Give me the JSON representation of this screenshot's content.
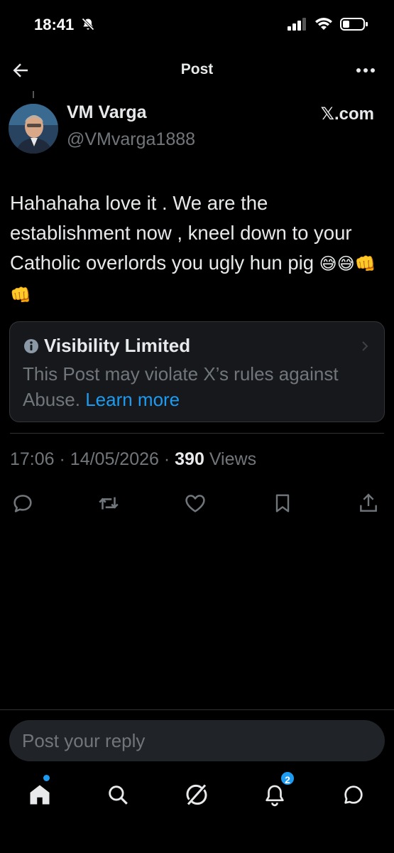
{
  "status_bar": {
    "time": "18:41",
    "icons": [
      "bell-slash-icon",
      "cellular-signal-icon",
      "wifi-icon",
      "battery-icon"
    ]
  },
  "header": {
    "title": "Post",
    "icons": [
      "back-arrow-icon",
      "more-icon"
    ]
  },
  "post": {
    "author_name": "VM Varga",
    "author_handle": "@VMvarga1888",
    "source_badge": "𝕏.com",
    "text": "Hahahaha love it . We are the establishment now , kneel down to your Catholic overlords you ugly hun pig",
    "emojis": "😅😅👊👊",
    "timestamp": "17:06",
    "date": "14/05/2026",
    "separator": "·",
    "views_count": "390",
    "views_label": "Views"
  },
  "visibility_notice": {
    "title": "Visibility Limited",
    "body": "This Post may violate X’s rules against Abuse.",
    "link": "Learn more"
  },
  "actions": [
    "reply-icon",
    "repost-icon",
    "like-icon",
    "bookmark-icon",
    "share-icon"
  ],
  "reply": {
    "placeholder": "Post your reply"
  },
  "tab_bar": {
    "tabs": [
      "home-icon",
      "search-icon",
      "grok-icon",
      "notifications-icon",
      "messages-icon"
    ],
    "notification_count": "2"
  },
  "colors": {
    "background": "#000000",
    "text": "#e7e9ea",
    "secondary": "#71767b",
    "accent": "#1d9bf0",
    "card": "#16181c"
  }
}
